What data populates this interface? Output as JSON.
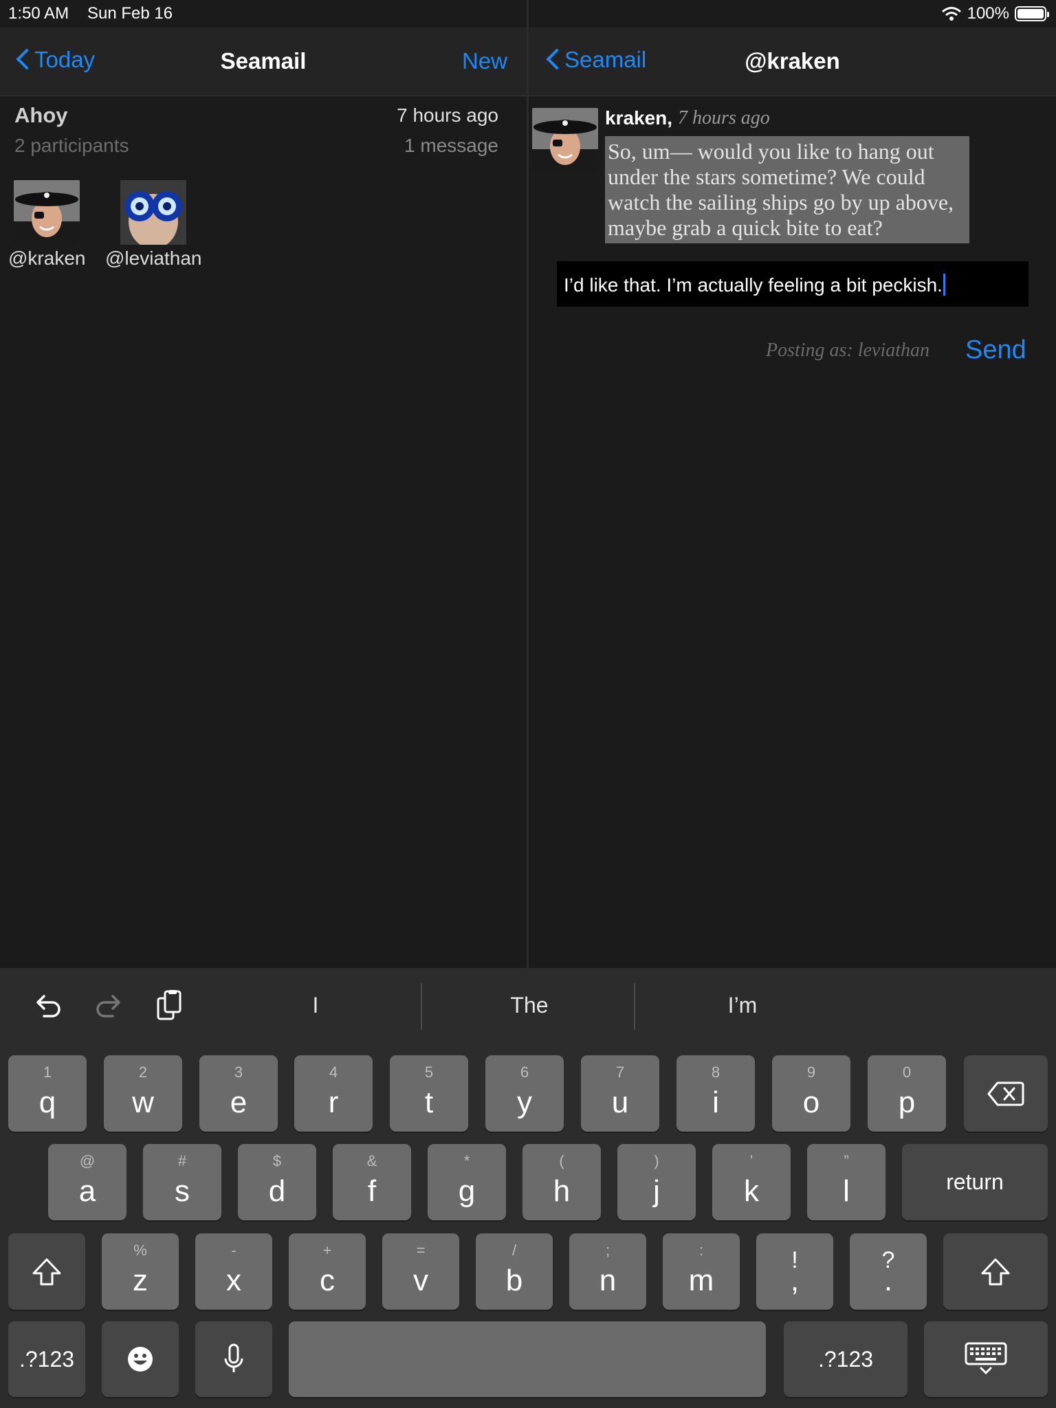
{
  "status_bar": {
    "time": "1:50 AM",
    "date": "Sun Feb 16",
    "battery": "100%"
  },
  "left_pane": {
    "nav": {
      "back_label": "Today",
      "title": "Seamail",
      "new_label": "New"
    },
    "thread": {
      "subject": "Ahoy",
      "participants_count": "2 participants",
      "time": "7 hours ago",
      "message_count": "1 message",
      "participants": [
        {
          "handle": "@kraken"
        },
        {
          "handle": "@leviathan"
        }
      ]
    }
  },
  "right_pane": {
    "nav": {
      "back_label": "Seamail",
      "title": "@kraken"
    },
    "message": {
      "author": "kraken,",
      "time": "7 hours ago",
      "body": "So, um— would you like to hang out under the stars sometime? We could watch the sailing ships go by up above, maybe grab a quick bite to eat?"
    },
    "reply_text": "I’d like that. I’m actually feeling a bit peckish.",
    "posting_as": "Posting as: leviathan",
    "send_label": "Send"
  },
  "keyboard": {
    "suggestions": [
      "I",
      "The",
      "I’m"
    ],
    "row1": [
      {
        "main": "q",
        "alt": "1"
      },
      {
        "main": "w",
        "alt": "2"
      },
      {
        "main": "e",
        "alt": "3"
      },
      {
        "main": "r",
        "alt": "4"
      },
      {
        "main": "t",
        "alt": "5"
      },
      {
        "main": "y",
        "alt": "6"
      },
      {
        "main": "u",
        "alt": "7"
      },
      {
        "main": "i",
        "alt": "8"
      },
      {
        "main": "o",
        "alt": "9"
      },
      {
        "main": "p",
        "alt": "0"
      }
    ],
    "row2": [
      {
        "main": "a",
        "alt": "@"
      },
      {
        "main": "s",
        "alt": "#"
      },
      {
        "main": "d",
        "alt": "$"
      },
      {
        "main": "f",
        "alt": "&"
      },
      {
        "main": "g",
        "alt": "*"
      },
      {
        "main": "h",
        "alt": "("
      },
      {
        "main": "j",
        "alt": ")"
      },
      {
        "main": "k",
        "alt": "’"
      },
      {
        "main": "l",
        "alt": "”"
      }
    ],
    "row3": [
      {
        "main": "z",
        "alt": "%"
      },
      {
        "main": "x",
        "alt": "-"
      },
      {
        "main": "c",
        "alt": "+"
      },
      {
        "main": "v",
        "alt": "="
      },
      {
        "main": "b",
        "alt": "/"
      },
      {
        "main": "n",
        "alt": ";"
      },
      {
        "main": "m",
        "alt": ":"
      },
      {
        "main": ",",
        "alt": "!"
      },
      {
        "main": ".",
        "alt": "?"
      }
    ],
    "return_label": "return",
    "numbers_label": ".?123"
  }
}
